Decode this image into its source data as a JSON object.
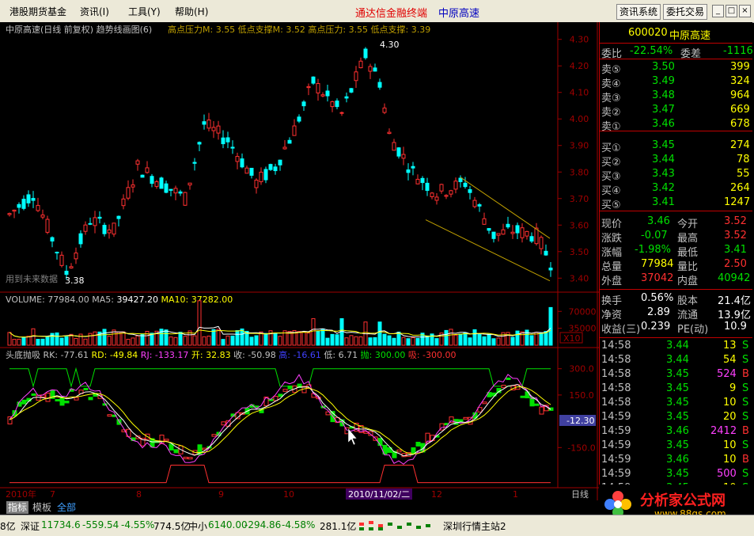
{
  "menubar": {
    "items": [
      "港股期货基金",
      "资讯(I)",
      "工具(Y)",
      "帮助(H)"
    ],
    "title_main": "通达信金融终端",
    "title_stock": "中原高速",
    "btn_info": "资讯系统",
    "btn_trade": "委托交易",
    "win_buttons": [
      "_",
      "□",
      "×"
    ]
  },
  "chart_header": {
    "title": "中原高速(日线 前复权) 趋势线画图(6)",
    "params": "高点压力M: 3.55  低点支撑M: 3.52  高点压力: 3.55  低点支撑: 3.39"
  },
  "chart_data": [
    {
      "type": "candlestick",
      "title": "中原高速(日线 前复权)",
      "y_ticks": [
        "4.30",
        "4.20",
        "4.10",
        "4.00",
        "3.90",
        "3.80",
        "3.70",
        "3.60",
        "3.50",
        "3.40"
      ],
      "ylim": [
        3.38,
        4.32
      ],
      "annotations": [
        "4.30",
        "3.38"
      ],
      "watermark": "用到未来数据",
      "trend_channel": {
        "upper_start": 3.78,
        "upper_end": 3.55,
        "lower_start": 3.62,
        "lower_end": 3.39
      }
    },
    {
      "type": "bar",
      "title": "VOLUME",
      "volume": "77984.00",
      "ma5": "39427.20",
      "ma10": "37282.00",
      "y_ticks": [
        "70000",
        "35000"
      ],
      "scale_label": "X10"
    },
    {
      "type": "line",
      "title": "头底抛吸",
      "rk": "-77.61",
      "rd": "-49.84",
      "rj": "-133.17",
      "open": "32.83",
      "close": "-50.98",
      "high": "-16.61",
      "low": "6.71",
      "sell": "300.00",
      "buy": "-300.00",
      "y_ticks": [
        "300.0",
        "150.0",
        "-150.0"
      ],
      "current": "-12.30"
    }
  ],
  "x_axis": {
    "labels": [
      "2010年",
      "7",
      "8",
      "9",
      "10",
      "2010/11/02/二",
      "12",
      "1"
    ],
    "period": "日线"
  },
  "quote": {
    "code": "600020",
    "name": "中原高速",
    "ratio_label": "委比",
    "ratio": "-22.54%",
    "diff_label": "委差",
    "diff": "-1116",
    "sells": [
      {
        "label": "卖⑤",
        "price": "3.50",
        "vol": "399"
      },
      {
        "label": "卖④",
        "price": "3.49",
        "vol": "324"
      },
      {
        "label": "卖③",
        "price": "3.48",
        "vol": "964"
      },
      {
        "label": "卖②",
        "price": "3.47",
        "vol": "669"
      },
      {
        "label": "卖①",
        "price": "3.46",
        "vol": "678"
      }
    ],
    "buys": [
      {
        "label": "买①",
        "price": "3.45",
        "vol": "274"
      },
      {
        "label": "买②",
        "price": "3.44",
        "vol": "78"
      },
      {
        "label": "买③",
        "price": "3.43",
        "vol": "55"
      },
      {
        "label": "买④",
        "price": "3.42",
        "vol": "264"
      },
      {
        "label": "买⑤",
        "price": "3.41",
        "vol": "1247"
      }
    ],
    "stats": [
      {
        "l1": "现价",
        "v1": "3.46",
        "c1": "#00E000",
        "l2": "今开",
        "v2": "3.52",
        "c2": "#FF3030"
      },
      {
        "l1": "涨跌",
        "v1": "-0.07",
        "c1": "#00E000",
        "l2": "最高",
        "v2": "3.52",
        "c2": "#FF3030"
      },
      {
        "l1": "涨幅",
        "v1": "-1.98%",
        "c1": "#00E000",
        "l2": "最低",
        "v2": "3.41",
        "c2": "#00E000"
      },
      {
        "l1": "总量",
        "v1": "77984",
        "c1": "#FFFF00",
        "l2": "量比",
        "v2": "2.50",
        "c2": "#FF3030"
      },
      {
        "l1": "外盘",
        "v1": "37042",
        "c1": "#FF3030",
        "l2": "内盘",
        "v2": "40942",
        "c2": "#00E000"
      }
    ],
    "fin": [
      {
        "l1": "换手",
        "v1": "0.56%",
        "l2": "股本",
        "v2": "21.4亿"
      },
      {
        "l1": "净资",
        "v1": "2.89",
        "l2": "流通",
        "v2": "13.9亿"
      },
      {
        "l1": "收益(三)",
        "v1": "0.239",
        "l2": "PE(动)",
        "v2": "10.9"
      }
    ],
    "ticks": [
      {
        "t": "14:58",
        "p": "3.44",
        "v": "13",
        "d": "S",
        "c": "#FFFF00"
      },
      {
        "t": "14:58",
        "p": "3.44",
        "v": "54",
        "d": "S",
        "c": "#FFFF00"
      },
      {
        "t": "14:58",
        "p": "3.45",
        "v": "524",
        "d": "B",
        "c": "#FF40FF"
      },
      {
        "t": "14:58",
        "p": "3.45",
        "v": "9",
        "d": "S",
        "c": "#FFFF00"
      },
      {
        "t": "14:58",
        "p": "3.45",
        "v": "10",
        "d": "S",
        "c": "#FFFF00"
      },
      {
        "t": "14:59",
        "p": "3.45",
        "v": "20",
        "d": "S",
        "c": "#FFFF00"
      },
      {
        "t": "14:59",
        "p": "3.46",
        "v": "2412",
        "d": "B",
        "c": "#FF40FF"
      },
      {
        "t": "14:59",
        "p": "3.45",
        "v": "10",
        "d": "S",
        "c": "#FFFF00"
      },
      {
        "t": "14:59",
        "p": "3.46",
        "v": "10",
        "d": "B",
        "c": "#FFFF00"
      },
      {
        "t": "14:59",
        "p": "3.45",
        "v": "500",
        "d": "S",
        "c": "#FF40FF"
      },
      {
        "t": "14:59",
        "p": "3.45",
        "v": "10",
        "d": "S",
        "c": "#FFFF00"
      }
    ]
  },
  "tabs": [
    "指标",
    "模板",
    "全部"
  ],
  "status": {
    "s1": "8亿",
    "sz_label": "深证",
    "sz_val": "11734.6",
    "sz_chg": "-559.54",
    "sz_pct": "-4.55%",
    "sz_amt": "774.5亿",
    "zx_label": "中小",
    "zx_val": "6140.00",
    "zx_chg": "-294.86",
    "zx_pct": "-4.58%",
    "zx_amt": "281.1亿",
    "server": "深圳行情主站2"
  },
  "logo": {
    "text": "分析家公式网",
    "url": "www.88gs.com"
  },
  "colors": {
    "up": "#FF3030",
    "down": "#00FFFF",
    "green": "#00E000",
    "yellow": "#FFFF00",
    "magenta": "#FF40FF",
    "grid": "#A00000"
  }
}
